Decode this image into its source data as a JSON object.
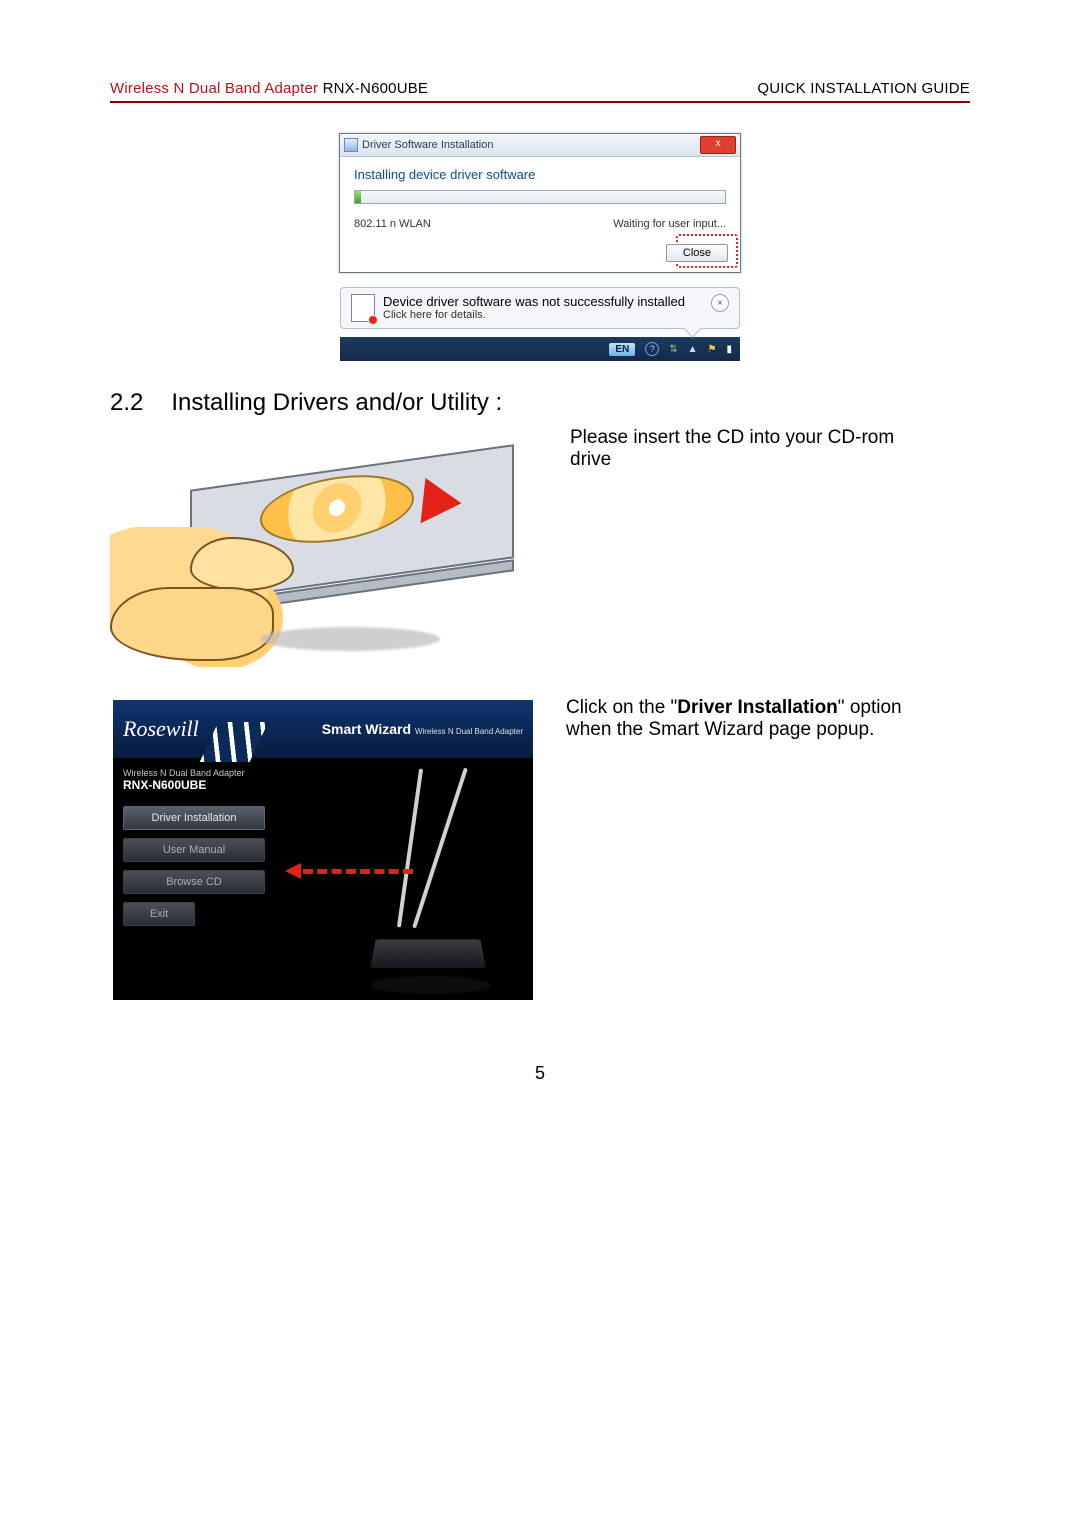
{
  "header": {
    "left_red": "Wireless N Dual Band Adapter",
    "left_black": " RNX-N600UBE",
    "right": "QUICK INSTALLATION GUIDE"
  },
  "dlg": {
    "title": "Driver Software Installation",
    "heading": "Installing device driver software",
    "device": "802.11 n WLAN",
    "status": "Waiting for user input...",
    "close": "Close",
    "close_x": "x"
  },
  "balloon": {
    "line1": "Device driver software was not successfully installed",
    "line2": "Click here for details.",
    "x": "×"
  },
  "taskbar": {
    "lang": "EN",
    "help": "?"
  },
  "section": {
    "num": "2.2",
    "title": "Installing Drivers and/or Utility :"
  },
  "step1_text": "Please insert the CD into your CD-rom drive",
  "wizard": {
    "brand": "Rosewill",
    "title": "Smart Wizard",
    "subtitle": "Wireless N Dual Band Adapter",
    "product_line1": "Wireless N Dual Band Adapter",
    "product_line2": "RNX-N600UBE",
    "buttons": {
      "driver": "Driver Installation",
      "manual": "User Manual",
      "browse": "Browse CD",
      "exit": "Exit"
    }
  },
  "step2": {
    "pre": "Click on the \"",
    "bold": "Driver Installation",
    "post": "\" option when the Smart Wizard page popup."
  },
  "page_number": "5"
}
